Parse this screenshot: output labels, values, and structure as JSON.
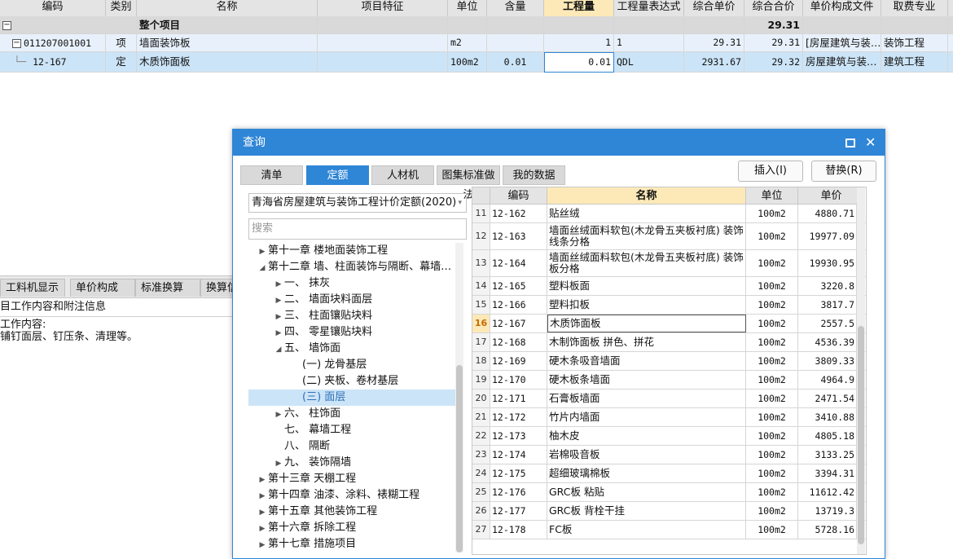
{
  "top_grid": {
    "headers": [
      "编码",
      "类别",
      "名称",
      "项目特征",
      "单位",
      "含量",
      "工程量",
      "工程量表达式",
      "综合单价",
      "综合合价",
      "单价构成文件",
      "取费专业"
    ],
    "rows": [
      {
        "code": "",
        "type": "",
        "name": "整个项目",
        "feature": "",
        "unit": "",
        "content": "",
        "qty": "",
        "expr": "",
        "price": "",
        "total": "29.31",
        "file": "",
        "fee": ""
      },
      {
        "code": "011207001001",
        "type": "项",
        "name": "墙面装饰板",
        "feature": "",
        "unit": "m2",
        "content": "",
        "qty": "1",
        "expr": "1",
        "price": "29.31",
        "total": "29.31",
        "file": "[房屋建筑与装…",
        "fee": "装饰工程"
      },
      {
        "code": "12-167",
        "type": "定",
        "name": "木质饰面板",
        "feature": "",
        "unit": "100m2",
        "content": "0.01",
        "qty": "0.01",
        "expr": "QDL",
        "price": "2931.67",
        "total": "29.32",
        "file": "房屋建筑与装…",
        "fee": "建筑工程"
      }
    ]
  },
  "bottom_panel": {
    "tabs": [
      "工料机显示",
      "单价构成",
      "标准换算",
      "换算信"
    ],
    "section_title": "目工作内容和附注信息",
    "work_label": "工作内容:",
    "work_text": "铺钉面层、钉压条、清理等。"
  },
  "dialog": {
    "title": "查询",
    "tabs": [
      "清单",
      "定额",
      "人材机",
      "图集标准做法",
      "我的数据"
    ],
    "active_tab": "定额",
    "buttons": {
      "insert": "插入(I)",
      "replace": "替换(R)"
    },
    "quota_book": "青海省房屋建筑与装饰工程计价定额(2020)",
    "search_placeholder": "搜索",
    "tree": [
      {
        "label": "第十一章 楼地面装饰工程",
        "arrow": "▶",
        "level": 1
      },
      {
        "label": "第十二章 墙、柱面装饰与隔断、幕墙…",
        "arrow": "◢",
        "level": 1
      },
      {
        "label": "一、 抹灰",
        "arrow": "▶",
        "level": 2
      },
      {
        "label": "二、 墙面块料面层",
        "arrow": "▶",
        "level": 2
      },
      {
        "label": "三、 柱面镶贴块料",
        "arrow": "▶",
        "level": 2
      },
      {
        "label": "四、 零星镶贴块料",
        "arrow": "▶",
        "level": 2
      },
      {
        "label": "五、 墙饰面",
        "arrow": "◢",
        "level": 2
      },
      {
        "label": "(一) 龙骨基层",
        "arrow": "",
        "level": 3
      },
      {
        "label": "(二) 夹板、卷材基层",
        "arrow": "",
        "level": 3
      },
      {
        "label": "(三) 面层",
        "arrow": "",
        "level": 3,
        "selected": true
      },
      {
        "label": "六、 柱饰面",
        "arrow": "▶",
        "level": 2
      },
      {
        "label": "七、 幕墙工程",
        "arrow": "",
        "level": 2
      },
      {
        "label": "八、 隔断",
        "arrow": "",
        "level": 2
      },
      {
        "label": "九、 装饰隔墙",
        "arrow": "▶",
        "level": 2
      },
      {
        "label": "第十三章 天棚工程",
        "arrow": "▶",
        "level": 1
      },
      {
        "label": "第十四章 油漆、涂料、裱糊工程",
        "arrow": "▶",
        "level": 1
      },
      {
        "label": "第十五章 其他装饰工程",
        "arrow": "▶",
        "level": 1
      },
      {
        "label": "第十六章 拆除工程",
        "arrow": "▶",
        "level": 1
      },
      {
        "label": "第十七章 措施项目",
        "arrow": "▶",
        "level": 1
      }
    ],
    "table": {
      "headers": [
        "编码",
        "名称",
        "单位",
        "单价"
      ],
      "rows": [
        {
          "n": "11",
          "code": "12-162",
          "name": "贴丝绒",
          "unit": "100m2",
          "price": "4880.71"
        },
        {
          "n": "12",
          "code": "12-163",
          "name": "墙面丝绒面料软包(木龙骨五夹板衬底) 装饰线条分格",
          "unit": "100m2",
          "price": "19977.09"
        },
        {
          "n": "13",
          "code": "12-164",
          "name": "墙面丝绒面料软包(木龙骨五夹板衬底) 装饰板分格",
          "unit": "100m2",
          "price": "19930.95"
        },
        {
          "n": "14",
          "code": "12-165",
          "name": "塑料板面",
          "unit": "100m2",
          "price": "3220.8"
        },
        {
          "n": "15",
          "code": "12-166",
          "name": "塑料扣板",
          "unit": "100m2",
          "price": "3817.7"
        },
        {
          "n": "16",
          "code": "12-167",
          "name": "木质饰面板",
          "unit": "100m2",
          "price": "2557.5",
          "selected": true
        },
        {
          "n": "17",
          "code": "12-168",
          "name": "木制饰面板 拼色、拼花",
          "unit": "100m2",
          "price": "4536.39"
        },
        {
          "n": "18",
          "code": "12-169",
          "name": "硬木条吸音墙面",
          "unit": "100m2",
          "price": "3809.33"
        },
        {
          "n": "19",
          "code": "12-170",
          "name": "硬木板条墙面",
          "unit": "100m2",
          "price": "4964.9"
        },
        {
          "n": "20",
          "code": "12-171",
          "name": "石膏板墙面",
          "unit": "100m2",
          "price": "2471.54"
        },
        {
          "n": "21",
          "code": "12-172",
          "name": "竹片内墙面",
          "unit": "100m2",
          "price": "3410.88"
        },
        {
          "n": "22",
          "code": "12-173",
          "name": "柚木皮",
          "unit": "100m2",
          "price": "4805.18"
        },
        {
          "n": "23",
          "code": "12-174",
          "name": "岩棉吸音板",
          "unit": "100m2",
          "price": "3133.25"
        },
        {
          "n": "24",
          "code": "12-175",
          "name": "超细玻璃棉板",
          "unit": "100m2",
          "price": "3394.31"
        },
        {
          "n": "25",
          "code": "12-176",
          "name": "GRC板 粘贴",
          "unit": "100m2",
          "price": "11612.42"
        },
        {
          "n": "26",
          "code": "12-177",
          "name": "GRC板 背栓干挂",
          "unit": "100m2",
          "price": "13719.3"
        },
        {
          "n": "27",
          "code": "12-178",
          "name": "FC板",
          "unit": "100m2",
          "price": "5728.16"
        }
      ]
    }
  },
  "colors": {
    "accent": "#2f86d6",
    "header_highlight": "#fde9b8",
    "selected_row": "#cce4f7"
  }
}
